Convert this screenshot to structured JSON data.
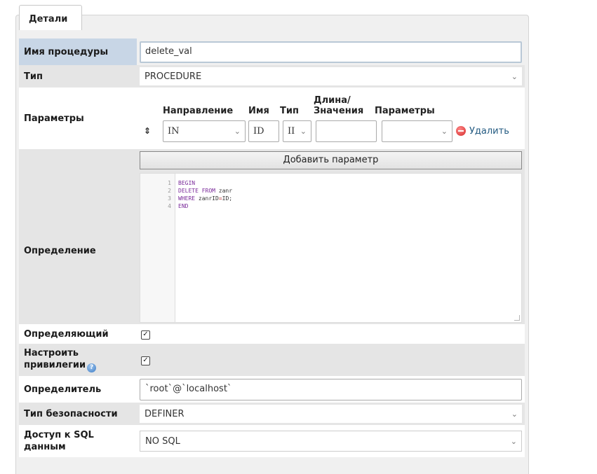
{
  "tab": {
    "label": "Детали"
  },
  "form": {
    "name": {
      "label": "Имя процедуры",
      "value": "delete_val"
    },
    "type": {
      "label": "Тип",
      "value": "PROCEDURE"
    },
    "params": {
      "label": "Параметры",
      "headers": {
        "direction": "Направление",
        "name": "Имя",
        "type": "Тип",
        "length_line1": "Длина/",
        "length_line2": "Значения",
        "options": "Параметры"
      },
      "row": {
        "handle": "⇕",
        "direction": "IN",
        "name": "ID",
        "type": "II",
        "length": "",
        "options": "",
        "delete_label": "Удалить"
      },
      "add_button": "Добавить параметр"
    },
    "definition": {
      "label": "Определение",
      "lines": [
        {
          "num": "1",
          "kw1": "BEGIN",
          "rest": ""
        },
        {
          "num": "2",
          "kw1": "DELETE FROM",
          "rest": " zanr"
        },
        {
          "num": "3",
          "kw1": "WHERE",
          "rest": " zanrID",
          "eq": "=",
          "tail": "ID;"
        },
        {
          "num": "4",
          "kw1": "END",
          "rest": ""
        }
      ]
    },
    "deterministic": {
      "label": "Определяющий",
      "checked": true
    },
    "adjust_privileges": {
      "label_line1": "Настроить",
      "label_line2": "привилегии",
      "checked": true
    },
    "definer": {
      "label": "Определитель",
      "value": "`root`@`localhost`"
    },
    "security_type": {
      "label": "Тип безопасности",
      "value": "DEFINER"
    },
    "sql_access": {
      "label_line1": "Доступ к SQL",
      "label_line2": "данным",
      "value": "NO SQL"
    }
  }
}
